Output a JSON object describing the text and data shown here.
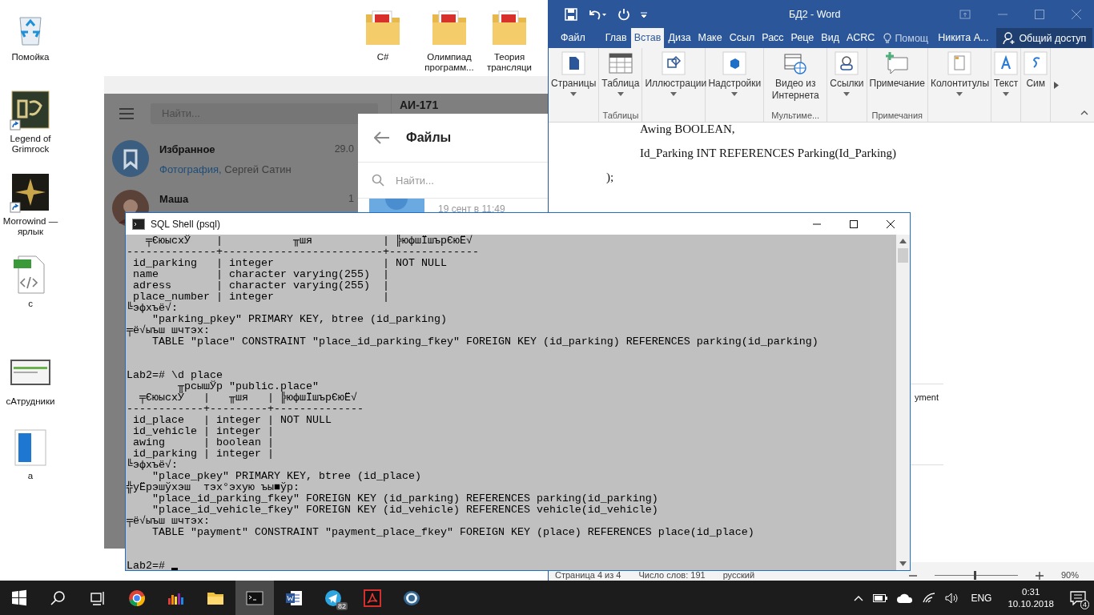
{
  "desktop_icons": [
    {
      "label": "Помойка",
      "kind": "recycle"
    },
    {
      "label": "Legend of Grimrock",
      "kind": "game-emblem",
      "shortcut": true
    },
    {
      "label": "Morrowind — ярлык",
      "kind": "game-star",
      "shortcut": true
    },
    {
      "label": "c",
      "kind": "code-file"
    },
    {
      "label": "сАтрудники",
      "kind": "window-thumb"
    },
    {
      "label": "а",
      "kind": "blue-doc"
    },
    {
      "label": "C#",
      "kind": "pdf-folder"
    },
    {
      "label": "Олимпиад программ...",
      "kind": "pdf-folder"
    },
    {
      "label": "Теория трансляци",
      "kind": "pdf-folder"
    }
  ],
  "telegram": {
    "search": {
      "placeholder": "Найти..."
    },
    "chats": [
      {
        "name": "Избранное",
        "kind": "saved",
        "time": "29.0",
        "media": "Фотография,",
        "preview": "Сергей Сатин"
      },
      {
        "name": "Маша",
        "kind": "person",
        "time": "1"
      }
    ],
    "chat_title": "АИ-171",
    "files_dialog": {
      "title": "Файлы",
      "search": {
        "placeholder": "Найти..."
      },
      "items": [
        {
          "date": "19 сент в 11:49"
        }
      ]
    }
  },
  "word": {
    "title": "БД2 - Word",
    "tabs": [
      {
        "label": "Файл",
        "selected": false
      },
      {
        "label": "Глав",
        "selected": false
      },
      {
        "label": "Встав",
        "selected": true
      },
      {
        "label": "Диза",
        "selected": false
      },
      {
        "label": "Маке",
        "selected": false
      },
      {
        "label": "Ссыл",
        "selected": false
      },
      {
        "label": "Расс",
        "selected": false
      },
      {
        "label": "Реце",
        "selected": false
      },
      {
        "label": "Вид",
        "selected": false
      },
      {
        "label": "ACRC",
        "selected": false
      }
    ],
    "help": "Помощ",
    "user": "Никита А...",
    "share": "Общий доступ",
    "ribbon": [
      {
        "buttons": [
          {
            "label": "Страницы",
            "kind": "pages",
            "dropdown": true
          }
        ]
      },
      {
        "label": "Таблицы",
        "buttons": [
          {
            "label": "Таблица",
            "kind": "table",
            "dropdown": true
          }
        ]
      },
      {
        "buttons": [
          {
            "label": "Иллюстрации",
            "kind": "shapes",
            "dropdown": true
          }
        ]
      },
      {
        "buttons": [
          {
            "label": "Надстройки",
            "kind": "addins",
            "dropdown": true
          }
        ]
      },
      {
        "label": "Мультиме...",
        "buttons": [
          {
            "label": "Видео из Интернета",
            "kind": "video",
            "dropdown": false
          }
        ]
      },
      {
        "buttons": [
          {
            "label": "Ссылки",
            "kind": "links",
            "dropdown": true
          }
        ]
      },
      {
        "label": "Примечания",
        "buttons": [
          {
            "label": "Примечание",
            "kind": "comment",
            "dropdown": false
          }
        ]
      },
      {
        "buttons": [
          {
            "label": "Колонтитулы",
            "kind": "header",
            "dropdown": true
          }
        ]
      },
      {
        "buttons": [
          {
            "label": "Текст",
            "kind": "text",
            "dropdown": true
          }
        ]
      },
      {
        "buttons": [
          {
            "label": "Сим",
            "kind": "symbol",
            "dropdown": false
          }
        ]
      }
    ],
    "document": [
      {
        "kind": "field",
        "text": "Awing BOOLEAN,"
      },
      {
        "kind": "field",
        "text": "Id_Parking INT REFERENCES Parking(Id_Parking)"
      },
      {
        "kind": "closing",
        "text": ");"
      }
    ],
    "table_fragment": "yment",
    "status": {
      "page": "Страница 4 из 4",
      "words": "Число слов: 191",
      "language": "русский",
      "zoom": "90%",
      "zoom_slider": {
        "level": 0.47
      }
    }
  },
  "console": {
    "title": "SQL Shell (psql)",
    "lines": [
      {
        "kind": "output",
        "text": "   ╤ЄюысхЎ    |           ╥шя           | ╠юфшЇшърЄюЁ√"
      },
      {
        "kind": "output",
        "text": "--------------+-------------------------+--------------"
      },
      {
        "kind": "output",
        "text": " id_parking   | integer                 | NOT NULL"
      },
      {
        "kind": "output",
        "text": " name         | character varying(255)  |"
      },
      {
        "kind": "output",
        "text": " adress       | character varying(255)  |"
      },
      {
        "kind": "output",
        "text": " place_number | integer                 |"
      },
      {
        "kind": "output",
        "text": "╚эфхъё√:"
      },
      {
        "kind": "output",
        "text": "    \"parking_pkey\" PRIMARY KEY, btree (id_parking)"
      },
      {
        "kind": "output",
        "text": "╤ё√ыъш шчтэх:"
      },
      {
        "kind": "output",
        "text": "    TABLE \"place\" CONSTRAINT \"place_id_parking_fkey\" FOREIGN KEY (id_parking) REFERENCES parking(id_parking)"
      },
      {
        "kind": "blank"
      },
      {
        "kind": "blank"
      },
      {
        "kind": "prompt",
        "text": "Lab2=# \\d place"
      },
      {
        "kind": "output",
        "text": "        ╥рсышЎр \"public.place\""
      },
      {
        "kind": "output",
        "text": "  ╤ЄюысхЎ   |   ╥шя   | ╠юфшЇшърЄюЁ√"
      },
      {
        "kind": "output",
        "text": "------------+---------+--------------"
      },
      {
        "kind": "output",
        "text": " id_place   | integer | NOT NULL"
      },
      {
        "kind": "output",
        "text": " id_vehicle | integer |"
      },
      {
        "kind": "output",
        "text": " awing      | boolean |"
      },
      {
        "kind": "output",
        "text": " id_parking | integer |"
      },
      {
        "kind": "output",
        "text": "╚эфхъё√:"
      },
      {
        "kind": "output",
        "text": "    \"place_pkey\" PRIMARY KEY, btree (id_place)"
      },
      {
        "kind": "output",
        "text": "╬уЁрэшўхэш  тэх°эхую ъы■ўр:"
      },
      {
        "kind": "output",
        "text": "    \"place_id_parking_fkey\" FOREIGN KEY (id_parking) REFERENCES parking(id_parking)"
      },
      {
        "kind": "output",
        "text": "    \"place_id_vehicle_fkey\" FOREIGN KEY (id_vehicle) REFERENCES vehicle(id_vehicle)"
      },
      {
        "kind": "output",
        "text": "╤ё√ыъш шчтэх:"
      },
      {
        "kind": "output",
        "text": "    TABLE \"payment\" CONSTRAINT \"payment_place_fkey\" FOREIGN KEY (place) REFERENCES place(id_place)"
      },
      {
        "kind": "blank"
      },
      {
        "kind": "blank"
      },
      {
        "kind": "prompt",
        "text": "Lab2=#",
        "cursor": true
      }
    ]
  },
  "taskbar": {
    "apps": [
      {
        "kind": "start",
        "selected": false
      },
      {
        "kind": "search",
        "selected": false
      },
      {
        "kind": "task-view",
        "selected": false
      },
      {
        "kind": "browser",
        "selected": false
      },
      {
        "kind": "equalizer",
        "selected": false
      },
      {
        "kind": "folder",
        "selected": false
      },
      {
        "kind": "terminal",
        "selected": true
      },
      {
        "kind": "word",
        "selected": false
      },
      {
        "kind": "messenger",
        "selected": false,
        "badge": "82"
      },
      {
        "kind": "pdf",
        "selected": false
      },
      {
        "kind": "database",
        "selected": false
      }
    ],
    "language": "ENG",
    "time": "0:31",
    "date": "10.10.2018",
    "notifications": "4"
  }
}
